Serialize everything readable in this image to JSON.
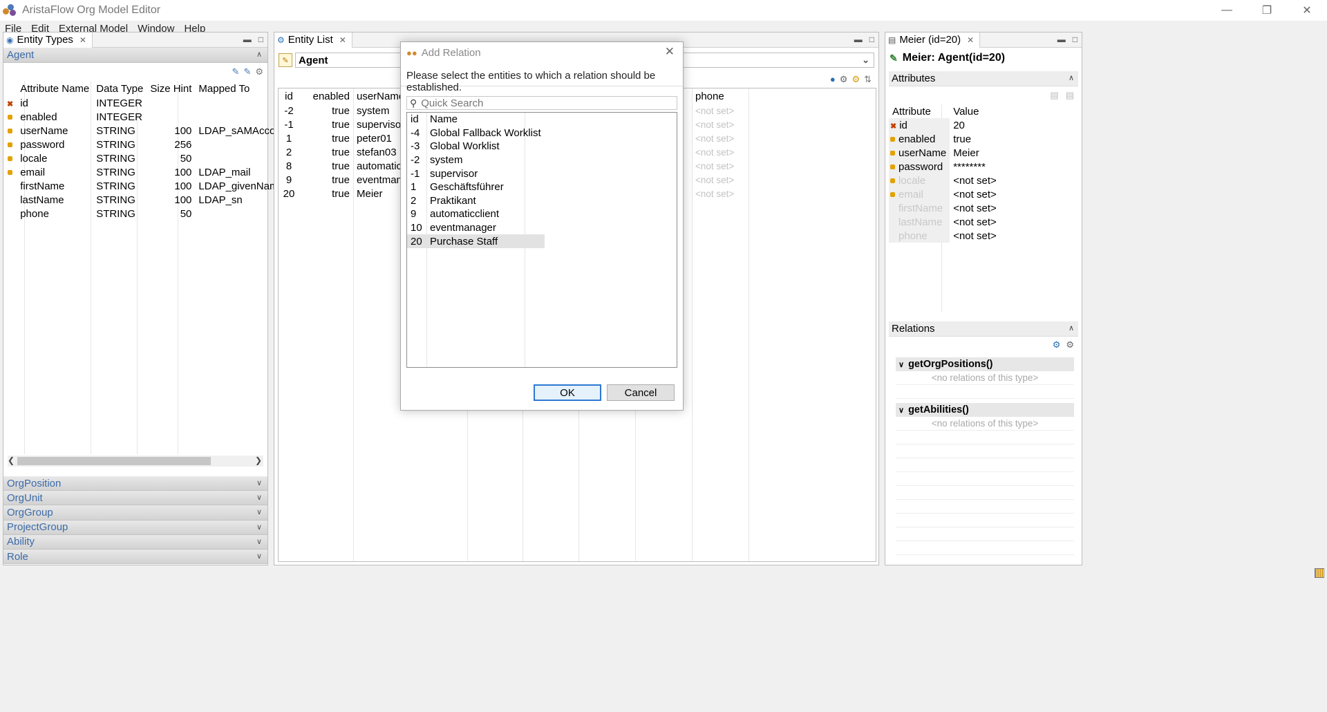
{
  "window": {
    "title": "AristaFlow Org Model Editor"
  },
  "menu": [
    "File",
    "Edit",
    "External Model",
    "Window",
    "Help"
  ],
  "entity_types": {
    "tab_label": "Entity Types",
    "active_type": "Agent",
    "columns": [
      "Attribute Name",
      "Data Type",
      "Size Hint",
      "Mapped To"
    ],
    "rows": [
      {
        "name": "id",
        "type": "INTEGER",
        "size": "",
        "mapped": "",
        "icon": "key"
      },
      {
        "name": "enabled",
        "type": "INTEGER",
        "size": "",
        "mapped": "",
        "icon": "lock"
      },
      {
        "name": "userName",
        "type": "STRING",
        "size": "100",
        "mapped": "LDAP_sAMAccountNar",
        "icon": "lock"
      },
      {
        "name": "password",
        "type": "STRING",
        "size": "256",
        "mapped": "",
        "icon": "lock"
      },
      {
        "name": "locale",
        "type": "STRING",
        "size": "50",
        "mapped": "",
        "icon": "lock"
      },
      {
        "name": "email",
        "type": "STRING",
        "size": "100",
        "mapped": "LDAP_mail",
        "icon": "lock"
      },
      {
        "name": "firstName",
        "type": "STRING",
        "size": "100",
        "mapped": "LDAP_givenName",
        "icon": ""
      },
      {
        "name": "lastName",
        "type": "STRING",
        "size": "100",
        "mapped": "LDAP_sn",
        "icon": ""
      },
      {
        "name": "phone",
        "type": "STRING",
        "size": "50",
        "mapped": "",
        "icon": ""
      }
    ],
    "other_types": [
      "OrgPosition",
      "OrgUnit",
      "OrgGroup",
      "ProjectGroup",
      "Ability",
      "Role"
    ]
  },
  "entity_list": {
    "tab_label": "Entity List",
    "selected_type": "Agent",
    "columns": [
      "id",
      "enabled",
      "userName",
      "phone"
    ],
    "rows": [
      {
        "id": "-2",
        "enabled": "true",
        "userName": "system",
        "phone": "<not set>"
      },
      {
        "id": "-1",
        "enabled": "true",
        "userName": "supervisor",
        "phone": "<not set>"
      },
      {
        "id": "1",
        "enabled": "true",
        "userName": "peter01",
        "phone": "<not set>"
      },
      {
        "id": "2",
        "enabled": "true",
        "userName": "stefan03",
        "phone": "<not set>"
      },
      {
        "id": "8",
        "enabled": "true",
        "userName": "automaticc...",
        "phone": "<not set>"
      },
      {
        "id": "9",
        "enabled": "true",
        "userName": "eventmana...",
        "phone": "<not set>"
      },
      {
        "id": "20",
        "enabled": "true",
        "userName": "Meier",
        "phone": "<not set>"
      }
    ]
  },
  "detail": {
    "tab_label": "Meier (id=20)",
    "heading": "Meier: Agent(id=20)",
    "attributes_label": "Attributes",
    "attr_columns": [
      "Attribute",
      "Value"
    ],
    "attributes": [
      {
        "name": "id",
        "value": "20",
        "icon": "key",
        "muted": false
      },
      {
        "name": "enabled",
        "value": "true",
        "icon": "lock",
        "muted": false
      },
      {
        "name": "userName",
        "value": "Meier",
        "icon": "lock",
        "muted": false
      },
      {
        "name": "password",
        "value": "********",
        "icon": "lock",
        "muted": false
      },
      {
        "name": "locale",
        "value": "<not set>",
        "icon": "lock",
        "muted": true
      },
      {
        "name": "email",
        "value": "<not set>",
        "icon": "lock",
        "muted": true
      },
      {
        "name": "firstName",
        "value": "<not set>",
        "icon": "",
        "muted": true
      },
      {
        "name": "lastName",
        "value": "<not set>",
        "icon": "",
        "muted": true
      },
      {
        "name": "phone",
        "value": "<not set>",
        "icon": "",
        "muted": true
      }
    ],
    "relations_label": "Relations",
    "relation_groups": [
      {
        "name": "getOrgPositions()",
        "empty": "<no relations of this type>"
      },
      {
        "name": "getAbilities()",
        "empty": "<no relations of this type>"
      }
    ]
  },
  "dialog": {
    "title": "Add Relation",
    "message": "Please select the entities to which a relation should be established.",
    "search_placeholder": "Quick Search",
    "columns": [
      "id",
      "Name"
    ],
    "rows": [
      {
        "id": "-4",
        "name": "Global Fallback Worklist"
      },
      {
        "id": "-3",
        "name": "Global Worklist"
      },
      {
        "id": "-2",
        "name": "system"
      },
      {
        "id": "-1",
        "name": "supervisor"
      },
      {
        "id": "1",
        "name": "Geschäftsführer"
      },
      {
        "id": "2",
        "name": "Praktikant"
      },
      {
        "id": "9",
        "name": "automaticclient"
      },
      {
        "id": "10",
        "name": "eventmanager"
      },
      {
        "id": "20",
        "name": "Purchase Staff"
      }
    ],
    "selected_id": "20",
    "ok_label": "OK",
    "cancel_label": "Cancel"
  }
}
